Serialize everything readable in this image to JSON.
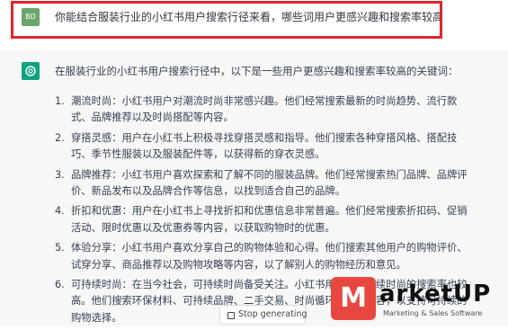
{
  "user_message": {
    "avatar_initials": "BD",
    "text": "你能结合服装行业的小红书用户搜索行径来看，哪些词用户更感兴趣和搜索率较高"
  },
  "assistant_message": {
    "avatar_icon": "openai-logo-icon",
    "intro": "在服装行业的小红书用户搜索行径中，以下是一些用户更感兴趣和搜索率较高的关键词：",
    "items": [
      {
        "num": "1.",
        "text": "潮流时尚：小红书用户对潮流时尚非常感兴趣。他们经常搜索最新的时尚趋势、流行款式、品牌推荐以及时尚搭配等内容。"
      },
      {
        "num": "2.",
        "text": "穿搭灵感：用户在小红书上积极寻找穿搭灵感和指导。他们搜索各种穿搭风格、搭配技巧、季节性服装以及服装配件等，以获得新的穿衣灵感。"
      },
      {
        "num": "3.",
        "text": "品牌推荐：小红书用户喜欢探索和了解不同的服装品牌。他们经常搜索热门品牌、品牌评价、新品发布以及品牌合作等信息，以找到适合自己的品牌。"
      },
      {
        "num": "4.",
        "text": "折扣和优惠：用户在小红书上寻找折扣和优惠信息非常普遍。他们经常搜索折扣码、促销活动、限时优惠以及优惠券等内容，以获取购物时的优惠。"
      },
      {
        "num": "5.",
        "text": "体验分享：小红书用户喜欢分享自己的购物体验和心得。他们搜索其他用户的购物评价、试穿分享、商品推荐以及购物攻略等内容，以了解别人的购物经历和意见。"
      },
      {
        "num": "6.",
        "text": "可持续时尚：在当今社会，可持续时尚备受关注。小红书用户对可持续时尚的搜索率也较高。他们搜索环保材料、可持续品牌、二手交易、时尚循环等相关内容，以支持可持续的购物选择。"
      }
    ]
  },
  "stop_button": {
    "label": "Stop generating"
  },
  "watermark": {
    "logo_letter": "M",
    "brand": "arketUP",
    "subtitle": "Marketing & Sales Software"
  },
  "colors": {
    "highlight": "#e0262b",
    "user_avatar": "#6aa56b",
    "bot_avatar": "#10a37f",
    "watermark": "#e8473f"
  }
}
